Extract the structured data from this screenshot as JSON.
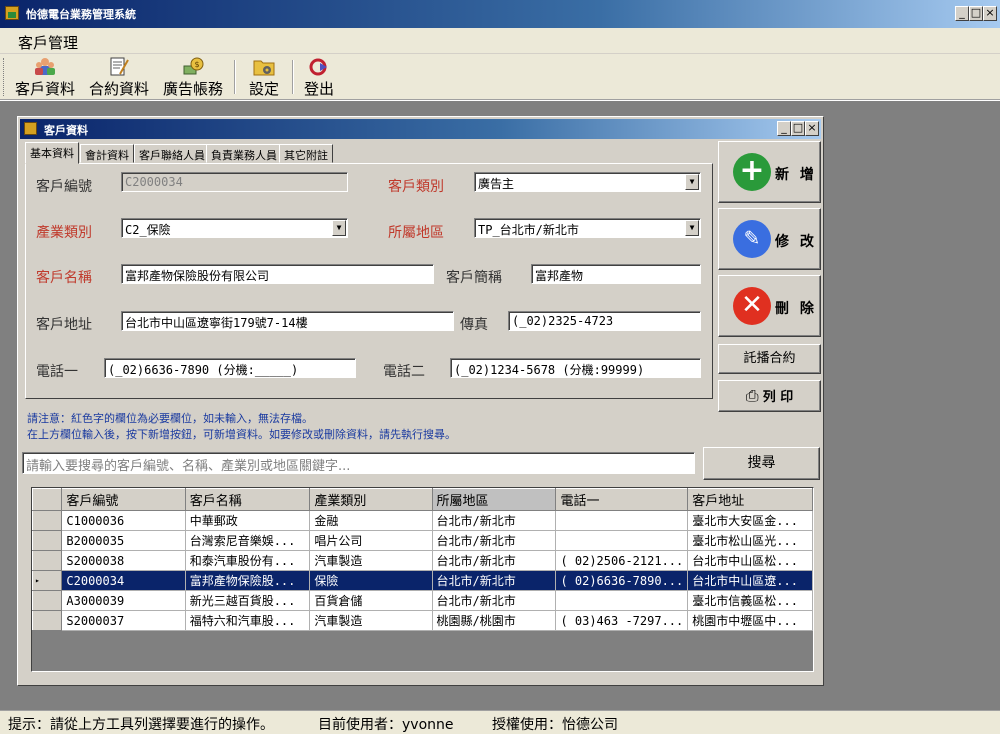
{
  "window": {
    "title": "怡德電台業務管理系統"
  },
  "menu": {
    "items": [
      "客戶管理"
    ]
  },
  "toolbar": {
    "buttons": [
      "客戶資料",
      "合約資料",
      "廣告帳務",
      "設定",
      "登出"
    ]
  },
  "child": {
    "title": "客戶資料",
    "tabs": [
      "基本資料",
      "會計資料",
      "客戶聯絡人員",
      "負責業務人員",
      "其它附註"
    ],
    "form": {
      "customer_id_label": "客戶編號",
      "customer_id": "C2000034",
      "customer_type_label": "客戶類別",
      "customer_type": "廣告主",
      "industry_label": "產業類別",
      "industry": "C2_保險",
      "region_label": "所屬地區",
      "region": "TP_台北市/新北市",
      "name_label": "客戶名稱",
      "name": "富邦產物保險股份有限公司",
      "short_name_label": "客戶簡稱",
      "short_name": "富邦產物",
      "address_label": "客戶地址",
      "address": "台北市中山區遼寧街179號7-14樓",
      "fax_label": "傳真",
      "fax": "(_02)2325-4723",
      "phone1_label": "電話一",
      "phone1": "(_02)6636-7890 (分機:_____)",
      "phone2_label": "電話二",
      "phone2": "(_02)1234-5678 (分機:99999)"
    },
    "actions": {
      "add": "新 增",
      "edit": "修 改",
      "delete": "刪 除",
      "broadcast": "託播合約",
      "print": "列 印"
    },
    "notes": [
      "請注意：紅色字的欄位為必要欄位，如未輸入，無法存檔。",
      "在上方欄位輸入後，按下新增按鈕，可新增資料。如要修改或刪除資料，請先執行搜尋。"
    ],
    "search": {
      "placeholder": "請輸入要搜尋的客戶編號、名稱、產業別或地區關鍵字...",
      "button": "搜尋"
    },
    "grid": {
      "columns": [
        "客戶編號",
        "客戶名稱",
        "產業類別",
        "所屬地區",
        "電話一",
        "客戶地址"
      ],
      "rows": [
        [
          "C1000036",
          "中華郵政",
          "金融",
          "台北市/新北市",
          "",
          "臺北市大安區金..."
        ],
        [
          "B2000035",
          "台灣索尼音樂娛...",
          "唱片公司",
          "台北市/新北市",
          "",
          "臺北市松山區光..."
        ],
        [
          "S2000038",
          "和泰汽車股份有...",
          "汽車製造",
          "台北市/新北市",
          "( 02)2506-2121...",
          "台北市中山區松..."
        ],
        [
          "C2000034",
          "富邦產物保險股...",
          "保險",
          "台北市/新北市",
          "( 02)6636-7890...",
          "台北市中山區遼..."
        ],
        [
          "A3000039",
          "新光三越百貨股...",
          "百貨倉儲",
          "台北市/新北市",
          "",
          "臺北市信義區松..."
        ],
        [
          "S2000037",
          "福特六和汽車股...",
          "汽車製造",
          "桃園縣/桃園市",
          "( 03)463 -7297...",
          "桃園市中壢區中..."
        ]
      ],
      "selected_row": 3
    }
  },
  "status": {
    "hint": "提示：請從上方工具列選擇要進行的操作。",
    "user": "目前使用者：yvonne",
    "license": "授權使用：怡德公司"
  }
}
